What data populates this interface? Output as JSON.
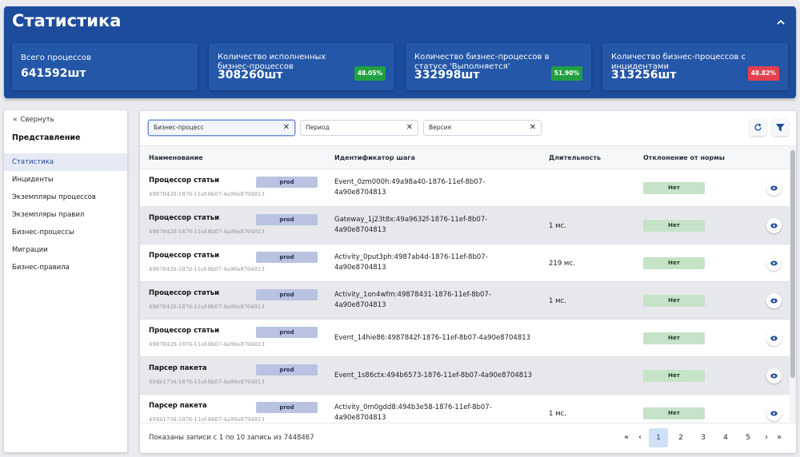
{
  "header": {
    "title": "Статистика",
    "collapse_icon": "chevron-up-icon",
    "cards": [
      {
        "label": "Всего процессов",
        "value": "641592шт",
        "badge": null
      },
      {
        "label": "Количество исполненных бизнес-процессов",
        "value": "308260шт",
        "badge": "48.05%",
        "badge_color": "#21a041"
      },
      {
        "label": "Количество бизнес-процессов в статусе 'Выполняется'",
        "value": "332998шт",
        "badge": "51.90%",
        "badge_color": "#21a041"
      },
      {
        "label": "Количество бизнес-процессов с инцидентами",
        "value": "313256шт",
        "badge": "48.82%",
        "badge_color": "#e5404f"
      }
    ]
  },
  "sidebar": {
    "collapse_label": "Свернуть",
    "collapse_icon": "double-chevron-left-icon",
    "heading": "Представление",
    "items": [
      {
        "label": "Статистика",
        "active": true
      },
      {
        "label": "Инциденты"
      },
      {
        "label": "Экземпляры процессов"
      },
      {
        "label": "Экземпляры правил"
      },
      {
        "label": "Бизнес-процессы"
      },
      {
        "label": "Миграции"
      },
      {
        "label": "Бизнес-правила"
      }
    ]
  },
  "filters": [
    {
      "placeholder": "Бизнес-процесс"
    },
    {
      "placeholder": "Период"
    },
    {
      "placeholder": "Версия"
    }
  ],
  "toolbar": {
    "refresh_icon": "refresh-icon",
    "filter_icon": "filter-settings-icon"
  },
  "table": {
    "columns": [
      "Наименование",
      "Идентификатор шага",
      "Длительность",
      "Отклонение от нормы"
    ],
    "rows": [
      {
        "name": "Процессор статьи",
        "id": "49878420-1876-11ef-8b07-4a90e8704813",
        "env": "prod",
        "step": "Event_0zm000h:49a98a40-1876-11ef-8b07-4a90e8704813",
        "duration": "",
        "deviation": "Нет"
      },
      {
        "name": "Процессор статьи",
        "id": "49878420-1876-11ef-8b07-4a90e8704813",
        "env": "prod",
        "step": "Gateway_1j23t8x:49a9632f-1876-11ef-8b07-4a90e8704813",
        "duration": "1 мс.",
        "deviation": "Нет"
      },
      {
        "name": "Процессор статьи",
        "id": "49878420-1876-11ef-8b07-4a90e8704813",
        "env": "prod",
        "step": "Activity_0put3ph:4987ab4d-1876-11ef-8b07-4a90e8704813",
        "duration": "219 мс.",
        "deviation": "Нет"
      },
      {
        "name": "Процессор статьи",
        "id": "49878420-1876-11ef-8b07-4a90e8704813",
        "env": "prod",
        "step": "Activity_1on4wfm:49878431-1876-11ef-8b07-4a90e8704813",
        "duration": "1 мс.",
        "deviation": "Нет"
      },
      {
        "name": "Процессор статьи",
        "id": "49878420-1876-11ef-8b07-4a90e8704813",
        "env": "prod",
        "step": "Event_14hie86:4987842f-1876-11ef-8b07-4a90e8704813",
        "duration": "",
        "deviation": "Нет"
      },
      {
        "name": "Парсер пакета",
        "id": "494b1734-1876-11ef-8b07-4a90e8704813",
        "env": "prod",
        "step": "Event_1s86ctx:494b6573-1876-11ef-8b07-4a90e8704813",
        "duration": "",
        "deviation": "Нет"
      },
      {
        "name": "Парсер пакета",
        "id": "494b1734-1876-11ef-8b07-4a90e8704813",
        "env": "prod",
        "step": "Activity_0m0gdd8:494b3e58-1876-11ef-8b07-4a90e8704813",
        "duration": "1 мс.",
        "deviation": "Нет"
      }
    ]
  },
  "footer": {
    "summary": "Показаны записи с 1 по 10 запись из 7448467",
    "pages": [
      "1",
      "2",
      "3",
      "4",
      "5"
    ],
    "current_page": "1",
    "first": "«",
    "prev": "‹",
    "next": "›",
    "last": "»"
  }
}
